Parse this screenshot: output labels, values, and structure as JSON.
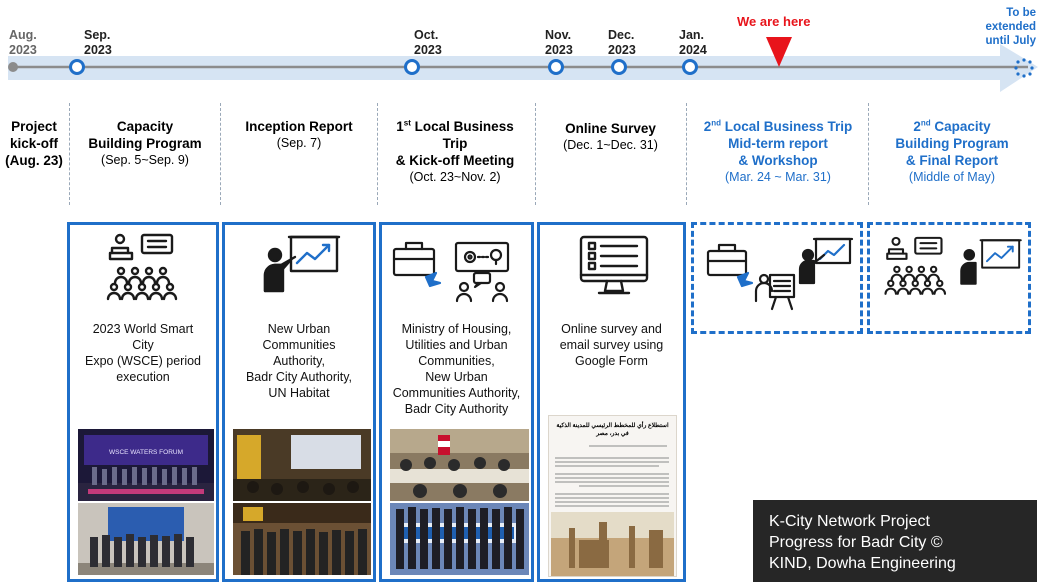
{
  "timeline": {
    "milestones": [
      {
        "month": "Aug.",
        "year": "2023"
      },
      {
        "month": "Sep.",
        "year": "2023"
      },
      {
        "month": "Oct.",
        "year": "2023"
      },
      {
        "month": "Nov.",
        "year": "2023"
      },
      {
        "month": "Dec.",
        "year": "2023"
      },
      {
        "month": "Jan.",
        "year": "2024"
      }
    ],
    "we_are_here": "We are here",
    "extension": {
      "line1": "To be",
      "line2": "extended",
      "line3": "until July"
    }
  },
  "phases": [
    {
      "title_lines": [
        "Project",
        "kick-off",
        "(Aug. 23)"
      ]
    },
    {
      "title_lines": [
        "Capacity",
        "Building Program"
      ],
      "date": "(Sep. 5~Sep. 9)"
    },
    {
      "title_lines": [
        "Inception Report"
      ],
      "date": "(Sep. 7)"
    },
    {
      "title_lines": [
        "Local Business",
        "Trip",
        "& Kick-off Meeting"
      ],
      "ordinal_num": "1",
      "ordinal_sup": "st",
      "date": "(Oct. 23~Nov. 2)"
    },
    {
      "title_lines": [
        "Online Survey"
      ],
      "date": "(Dec. 1~Dec. 31)"
    },
    {
      "title_lines": [
        "Local Business Trip",
        "Mid-term report",
        "& Workshop"
      ],
      "ordinal_num": "2",
      "ordinal_sup": "nd",
      "date": "(Mar. 24 ~ Mar. 31)"
    },
    {
      "title_lines": [
        "Capacity",
        "Building Program",
        "& Final Report"
      ],
      "ordinal_num": "2",
      "ordinal_sup": "nd",
      "date": "(Middle of May)"
    }
  ],
  "boxes": [
    {
      "desc_lines": [
        "2023 World Smart",
        "City",
        "Expo (WSCE) period",
        "execution"
      ],
      "photo_banner": "WSCE WATERS FORUM"
    },
    {
      "desc_lines": [
        "New Urban",
        "Communities",
        "Authority,",
        "Badr City Authority,",
        "UN Habitat"
      ]
    },
    {
      "desc_lines": [
        "Ministry of Housing,",
        "Utilities and Urban",
        "Communities,",
        "New Urban",
        "Communities Authority,",
        "Badr City Authority"
      ]
    },
    {
      "desc_lines": [
        "Online survey and",
        "email survey using",
        "Google Form"
      ],
      "doc_title": "استطلاع رأي للمخطط الرئيسي للمدينة الذكية في بدر، مصر"
    }
  ],
  "caption": {
    "lines": [
      "K-City Network Project",
      "Progress for Badr City ©",
      "KIND, Dowha Engineering"
    ]
  },
  "colors": {
    "accent": "#1f6fc9",
    "marker": "#e8141b",
    "timeline_band": "#d6e4f3",
    "caption_bg": "#262626"
  }
}
